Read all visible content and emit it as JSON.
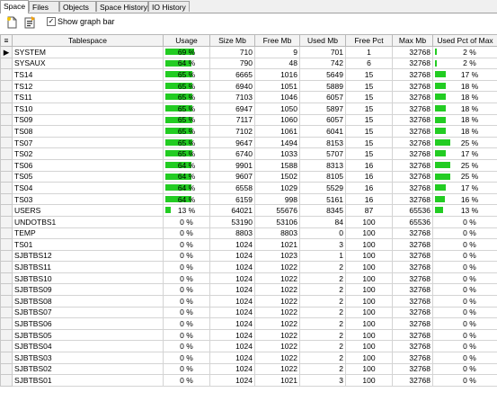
{
  "tabs": [
    "Space",
    "Files",
    "Objects",
    "Space History",
    "IO History"
  ],
  "toolbar": {
    "icons": [
      "new-page-icon",
      "export-icon"
    ],
    "show_graph_bar_label": "Show graph bar",
    "show_graph_bar_checked": true
  },
  "table": {
    "headers": [
      "Tablespace",
      "Usage",
      "Size Mb",
      "Free Mb",
      "Used Mb",
      "Free Pct",
      "Max Mb",
      "Used Pct of Max"
    ],
    "rows": [
      {
        "ts": "SYSTEM",
        "usage": "69 %",
        "usage_frac": 0.69,
        "size": "710",
        "free": "9",
        "used": "701",
        "fpct": "1",
        "max": "32768",
        "upct": "2 %",
        "upct_frac": 0.02,
        "ind": "▶"
      },
      {
        "ts": "SYSAUX",
        "usage": "64 %",
        "usage_frac": 0.64,
        "size": "790",
        "free": "48",
        "used": "742",
        "fpct": "6",
        "max": "32768",
        "upct": "2 %",
        "upct_frac": 0.02,
        "ind": ""
      },
      {
        "ts": "TS14",
        "usage": "65 %",
        "usage_frac": 0.65,
        "size": "6665",
        "free": "1016",
        "used": "5649",
        "fpct": "15",
        "max": "32768",
        "upct": "17 %",
        "upct_frac": 0.17,
        "ind": ""
      },
      {
        "ts": "TS12",
        "usage": "65 %",
        "usage_frac": 0.65,
        "size": "6940",
        "free": "1051",
        "used": "5889",
        "fpct": "15",
        "max": "32768",
        "upct": "18 %",
        "upct_frac": 0.18,
        "ind": ""
      },
      {
        "ts": "TS11",
        "usage": "65 %",
        "usage_frac": 0.65,
        "size": "7103",
        "free": "1046",
        "used": "6057",
        "fpct": "15",
        "max": "32768",
        "upct": "18 %",
        "upct_frac": 0.18,
        "ind": ""
      },
      {
        "ts": "TS10",
        "usage": "65 %",
        "usage_frac": 0.65,
        "size": "6947",
        "free": "1050",
        "used": "5897",
        "fpct": "15",
        "max": "32768",
        "upct": "18 %",
        "upct_frac": 0.18,
        "ind": ""
      },
      {
        "ts": "TS09",
        "usage": "65 %",
        "usage_frac": 0.65,
        "size": "7117",
        "free": "1060",
        "used": "6057",
        "fpct": "15",
        "max": "32768",
        "upct": "18 %",
        "upct_frac": 0.18,
        "ind": ""
      },
      {
        "ts": "TS08",
        "usage": "65 %",
        "usage_frac": 0.65,
        "size": "7102",
        "free": "1061",
        "used": "6041",
        "fpct": "15",
        "max": "32768",
        "upct": "18 %",
        "upct_frac": 0.18,
        "ind": ""
      },
      {
        "ts": "TS07",
        "usage": "65 %",
        "usage_frac": 0.65,
        "size": "9647",
        "free": "1494",
        "used": "8153",
        "fpct": "15",
        "max": "32768",
        "upct": "25 %",
        "upct_frac": 0.25,
        "ind": ""
      },
      {
        "ts": "TS02",
        "usage": "65 %",
        "usage_frac": 0.65,
        "size": "6740",
        "free": "1033",
        "used": "5707",
        "fpct": "15",
        "max": "32768",
        "upct": "17 %",
        "upct_frac": 0.17,
        "ind": ""
      },
      {
        "ts": "TS06",
        "usage": "64 %",
        "usage_frac": 0.64,
        "size": "9901",
        "free": "1588",
        "used": "8313",
        "fpct": "16",
        "max": "32768",
        "upct": "25 %",
        "upct_frac": 0.25,
        "ind": ""
      },
      {
        "ts": "TS05",
        "usage": "64 %",
        "usage_frac": 0.64,
        "size": "9607",
        "free": "1502",
        "used": "8105",
        "fpct": "16",
        "max": "32768",
        "upct": "25 %",
        "upct_frac": 0.25,
        "ind": ""
      },
      {
        "ts": "TS04",
        "usage": "64 %",
        "usage_frac": 0.64,
        "size": "6558",
        "free": "1029",
        "used": "5529",
        "fpct": "16",
        "max": "32768",
        "upct": "17 %",
        "upct_frac": 0.17,
        "ind": ""
      },
      {
        "ts": "TS03",
        "usage": "64 %",
        "usage_frac": 0.64,
        "size": "6159",
        "free": "998",
        "used": "5161",
        "fpct": "16",
        "max": "32768",
        "upct": "16 %",
        "upct_frac": 0.16,
        "ind": ""
      },
      {
        "ts": "USERS",
        "usage": "13 %",
        "usage_frac": 0.13,
        "size": "64021",
        "free": "55676",
        "used": "8345",
        "fpct": "87",
        "max": "65536",
        "upct": "13 %",
        "upct_frac": 0.13,
        "ind": ""
      },
      {
        "ts": "UNDOTBS1",
        "usage": "0 %",
        "usage_frac": 0,
        "size": "53190",
        "free": "53106",
        "used": "84",
        "fpct": "100",
        "max": "65536",
        "upct": "0 %",
        "upct_frac": 0,
        "ind": ""
      },
      {
        "ts": "TEMP",
        "usage": "0 %",
        "usage_frac": 0,
        "size": "8803",
        "free": "8803",
        "used": "0",
        "fpct": "100",
        "max": "32768",
        "upct": "0 %",
        "upct_frac": 0,
        "ind": ""
      },
      {
        "ts": "TS01",
        "usage": "0 %",
        "usage_frac": 0,
        "size": "1024",
        "free": "1021",
        "used": "3",
        "fpct": "100",
        "max": "32768",
        "upct": "0 %",
        "upct_frac": 0,
        "ind": ""
      },
      {
        "ts": "SJBTBS12",
        "usage": "0 %",
        "usage_frac": 0,
        "size": "1024",
        "free": "1023",
        "used": "1",
        "fpct": "100",
        "max": "32768",
        "upct": "0 %",
        "upct_frac": 0,
        "ind": ""
      },
      {
        "ts": "SJBTBS11",
        "usage": "0 %",
        "usage_frac": 0,
        "size": "1024",
        "free": "1022",
        "used": "2",
        "fpct": "100",
        "max": "32768",
        "upct": "0 %",
        "upct_frac": 0,
        "ind": ""
      },
      {
        "ts": "SJBTBS10",
        "usage": "0 %",
        "usage_frac": 0,
        "size": "1024",
        "free": "1022",
        "used": "2",
        "fpct": "100",
        "max": "32768",
        "upct": "0 %",
        "upct_frac": 0,
        "ind": ""
      },
      {
        "ts": "SJBTBS09",
        "usage": "0 %",
        "usage_frac": 0,
        "size": "1024",
        "free": "1022",
        "used": "2",
        "fpct": "100",
        "max": "32768",
        "upct": "0 %",
        "upct_frac": 0,
        "ind": ""
      },
      {
        "ts": "SJBTBS08",
        "usage": "0 %",
        "usage_frac": 0,
        "size": "1024",
        "free": "1022",
        "used": "2",
        "fpct": "100",
        "max": "32768",
        "upct": "0 %",
        "upct_frac": 0,
        "ind": ""
      },
      {
        "ts": "SJBTBS07",
        "usage": "0 %",
        "usage_frac": 0,
        "size": "1024",
        "free": "1022",
        "used": "2",
        "fpct": "100",
        "max": "32768",
        "upct": "0 %",
        "upct_frac": 0,
        "ind": ""
      },
      {
        "ts": "SJBTBS06",
        "usage": "0 %",
        "usage_frac": 0,
        "size": "1024",
        "free": "1022",
        "used": "2",
        "fpct": "100",
        "max": "32768",
        "upct": "0 %",
        "upct_frac": 0,
        "ind": ""
      },
      {
        "ts": "SJBTBS05",
        "usage": "0 %",
        "usage_frac": 0,
        "size": "1024",
        "free": "1022",
        "used": "2",
        "fpct": "100",
        "max": "32768",
        "upct": "0 %",
        "upct_frac": 0,
        "ind": ""
      },
      {
        "ts": "SJBTBS04",
        "usage": "0 %",
        "usage_frac": 0,
        "size": "1024",
        "free": "1022",
        "used": "2",
        "fpct": "100",
        "max": "32768",
        "upct": "0 %",
        "upct_frac": 0,
        "ind": ""
      },
      {
        "ts": "SJBTBS03",
        "usage": "0 %",
        "usage_frac": 0,
        "size": "1024",
        "free": "1022",
        "used": "2",
        "fpct": "100",
        "max": "32768",
        "upct": "0 %",
        "upct_frac": 0,
        "ind": ""
      },
      {
        "ts": "SJBTBS02",
        "usage": "0 %",
        "usage_frac": 0,
        "size": "1024",
        "free": "1022",
        "used": "2",
        "fpct": "100",
        "max": "32768",
        "upct": "0 %",
        "upct_frac": 0,
        "ind": ""
      },
      {
        "ts": "SJBTBS01",
        "usage": "0 %",
        "usage_frac": 0,
        "size": "1024",
        "free": "1021",
        "used": "3",
        "fpct": "100",
        "max": "32768",
        "upct": "0 %",
        "upct_frac": 0,
        "ind": ""
      }
    ]
  },
  "colors": {
    "bar": "#22cc22",
    "grid_line": "#d4d4d4",
    "header_bg": "#f3f3f3"
  }
}
